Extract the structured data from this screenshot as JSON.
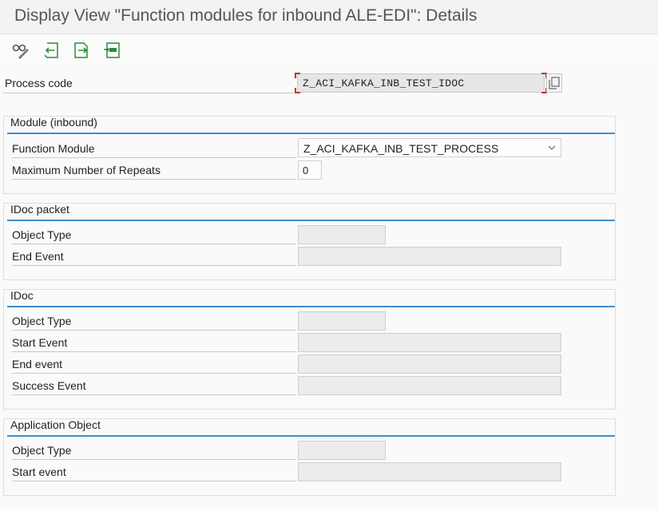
{
  "window": {
    "title": "Display View \"Function modules for inbound ALE-EDI\": Details"
  },
  "toolbar": {
    "buttons": [
      {
        "icon": "glasses-icon",
        "name": "display-change-button"
      },
      {
        "icon": "previous-entry-icon",
        "name": "previous-entry-button"
      },
      {
        "icon": "next-entry-icon",
        "name": "next-entry-button"
      },
      {
        "icon": "select-block-icon",
        "name": "select-button"
      }
    ]
  },
  "header": {
    "process_code_label": "Process code",
    "process_code_value": "Z_ACI_KAFKA_INB_TEST_IDOC"
  },
  "module_inbound": {
    "title": "Module (inbound)",
    "function_module_label": "Function Module",
    "function_module_value": "Z_ACI_KAFKA_INB_TEST_PROCESS",
    "max_repeats_label": "Maximum Number of Repeats",
    "max_repeats_value": "0"
  },
  "idoc_packet": {
    "title": "IDoc packet",
    "object_type_label": "Object Type",
    "object_type_value": "",
    "end_event_label": "End Event",
    "end_event_value": ""
  },
  "idoc": {
    "title": "IDoc",
    "object_type_label": "Object Type",
    "object_type_value": "",
    "start_event_label": "Start Event",
    "start_event_value": "",
    "end_event_label": "End event",
    "end_event_value": "",
    "success_event_label": "Success Event",
    "success_event_value": ""
  },
  "application_object": {
    "title": "Application Object",
    "object_type_label": "Object Type",
    "object_type_value": "",
    "start_event_label": "Start event",
    "start_event_value": ""
  },
  "colors": {
    "accent": "#3d8fd1",
    "focus": "#c0392b"
  }
}
